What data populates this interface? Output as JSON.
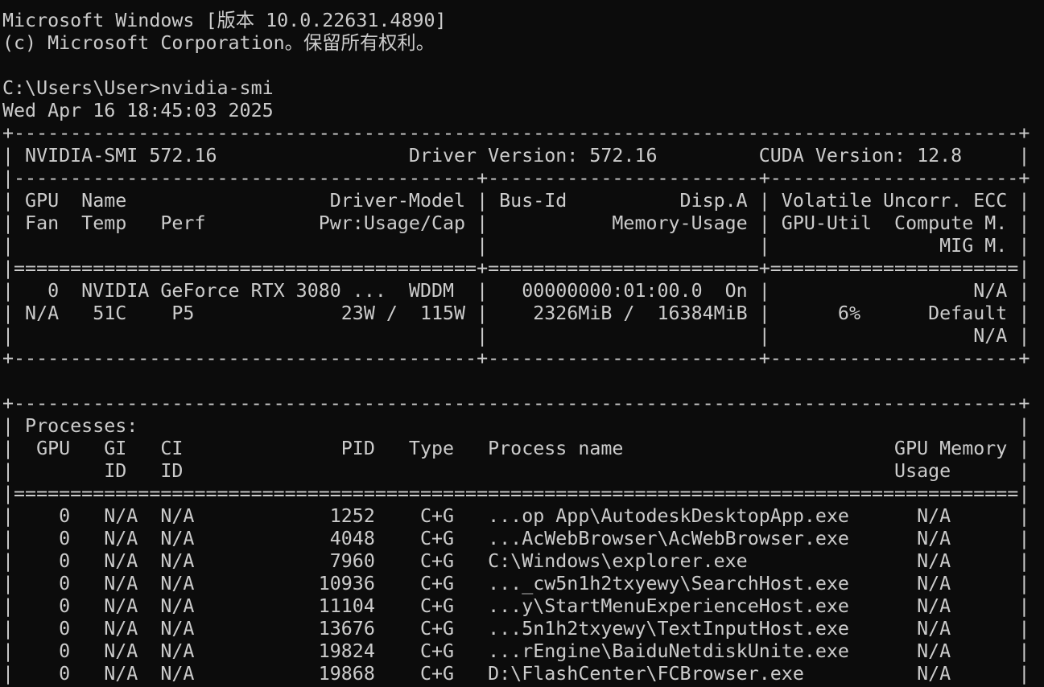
{
  "terminal": {
    "lines": [
      "Microsoft Windows [版本 10.0.22631.4890]",
      "(c) Microsoft Corporation。保留所有权利。",
      "",
      "C:\\Users\\User>nvidia-smi",
      "Wed Apr 16 18:45:03 2025",
      "+-----------------------------------------------------------------------------------------+",
      "| NVIDIA-SMI 572.16                 Driver Version: 572.16         CUDA Version: 12.8     |",
      "|-----------------------------------------+------------------------+----------------------+",
      "| GPU  Name                  Driver-Model | Bus-Id          Disp.A | Volatile Uncorr. ECC |",
      "| Fan  Temp   Perf          Pwr:Usage/Cap |           Memory-Usage | GPU-Util  Compute M. |",
      "|                                         |                        |               MIG M. |",
      "|=========================================+========================+======================|",
      "|   0  NVIDIA GeForce RTX 3080 ...  WDDM  |   00000000:01:00.0  On |                  N/A |",
      "| N/A   51C    P5             23W /  115W |    2326MiB /  16384MiB |      6%      Default |",
      "|                                         |                        |                  N/A |",
      "+-----------------------------------------+------------------------+----------------------+",
      "",
      "+-----------------------------------------------------------------------------------------+",
      "| Processes:                                                                              |",
      "|  GPU   GI   CI              PID   Type   Process name                        GPU Memory |",
      "|        ID   ID                                                               Usage      |",
      "|=========================================================================================|",
      "|    0   N/A  N/A            1252    C+G   ...op App\\AutodeskDesktopApp.exe      N/A      |",
      "|    0   N/A  N/A            4048    C+G   ...AcWebBrowser\\AcWebBrowser.exe      N/A      |",
      "|    0   N/A  N/A            7960    C+G   C:\\Windows\\explorer.exe               N/A      |",
      "|    0   N/A  N/A           10936    C+G   ..._cw5n1h2txyewy\\SearchHost.exe      N/A      |",
      "|    0   N/A  N/A           11104    C+G   ...y\\StartMenuExperienceHost.exe      N/A      |",
      "|    0   N/A  N/A           13676    C+G   ...5n1h2txyewy\\TextInputHost.exe      N/A      |",
      "|    0   N/A  N/A           19824    C+G   ...rEngine\\BaiduNetdiskUnite.exe      N/A      |",
      "|    0   N/A  N/A           19868    C+G   D:\\FlashCenter\\FCBrowser.exe          N/A      |"
    ]
  }
}
